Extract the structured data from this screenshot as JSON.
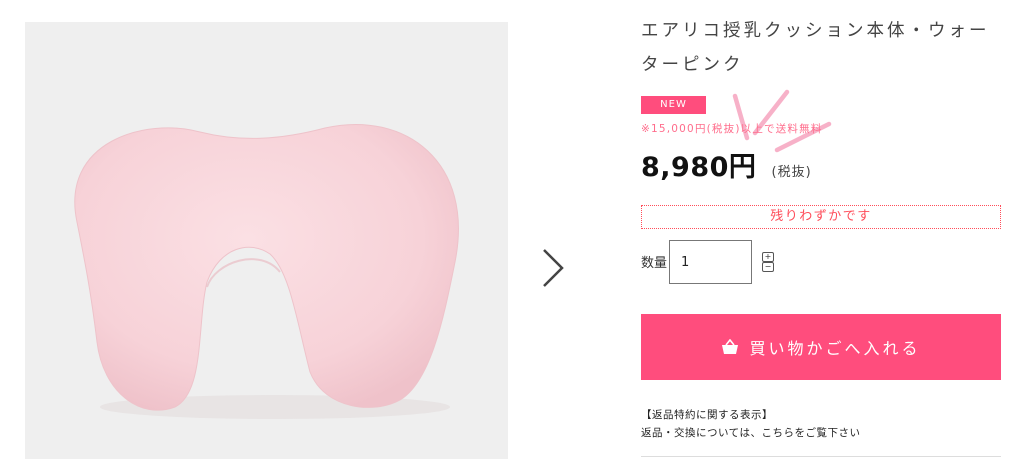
{
  "product": {
    "title": "エアリコ授乳クッション本体・ウォーターピンク",
    "badge": "NEW",
    "shipping_note": "※15,000円(税抜)以上で送料無料",
    "price": "8,980円",
    "tax_note": "(税抜)",
    "stock_status": "残りわずかです",
    "image_icon": "nursing-pillow-image"
  },
  "quantity": {
    "label": "数量",
    "value": "1"
  },
  "cart": {
    "button_label": "買い物かごへ入れる",
    "icon": "basket-icon"
  },
  "returns": {
    "title": "【返品特約に関する表示】",
    "text": "返品・交換については、こちらをご覧下さい"
  },
  "colors": {
    "accent": "#ff4d7d",
    "stock_border": "#ff4d5a",
    "pillow": "#f9dbdf"
  }
}
